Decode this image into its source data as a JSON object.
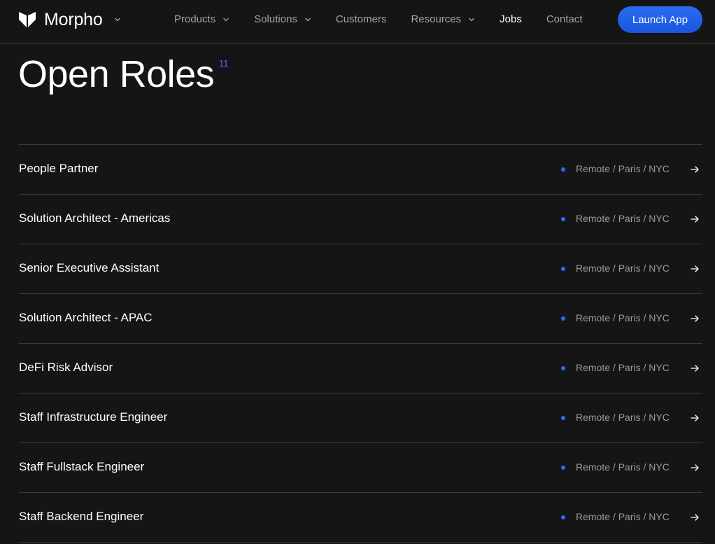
{
  "brand": {
    "name": "Morpho",
    "logo_icon": "morpho-butterfly-icon"
  },
  "nav": {
    "items": [
      {
        "label": "Products",
        "dropdown": true
      },
      {
        "label": "Solutions",
        "dropdown": true
      },
      {
        "label": "Customers",
        "dropdown": false
      },
      {
        "label": "Resources",
        "dropdown": true
      },
      {
        "label": "Jobs",
        "dropdown": false,
        "active": true
      },
      {
        "label": "Contact",
        "dropdown": false
      }
    ],
    "cta_label": "Launch App"
  },
  "page": {
    "title": "Open Roles",
    "count": "11"
  },
  "roles": [
    {
      "title": "People Partner",
      "location": "Remote / Paris / NYC"
    },
    {
      "title": "Solution Architect - Americas",
      "location": "Remote / Paris / NYC"
    },
    {
      "title": "Senior Executive Assistant",
      "location": "Remote / Paris / NYC"
    },
    {
      "title": "Solution Architect - APAC",
      "location": "Remote / Paris / NYC"
    },
    {
      "title": "DeFi Risk Advisor",
      "location": "Remote / Paris / NYC"
    },
    {
      "title": "Staff Infrastructure Engineer",
      "location": "Remote / Paris / NYC"
    },
    {
      "title": "Staff Fullstack Engineer",
      "location": "Remote / Paris / NYC"
    },
    {
      "title": "Staff Backend Engineer",
      "location": "Remote / Paris / NYC"
    }
  ],
  "colors": {
    "background": "#151515",
    "accent": "#2f6cf5",
    "text_muted": "#9a9a9a",
    "divider": "#3a3a3a"
  }
}
